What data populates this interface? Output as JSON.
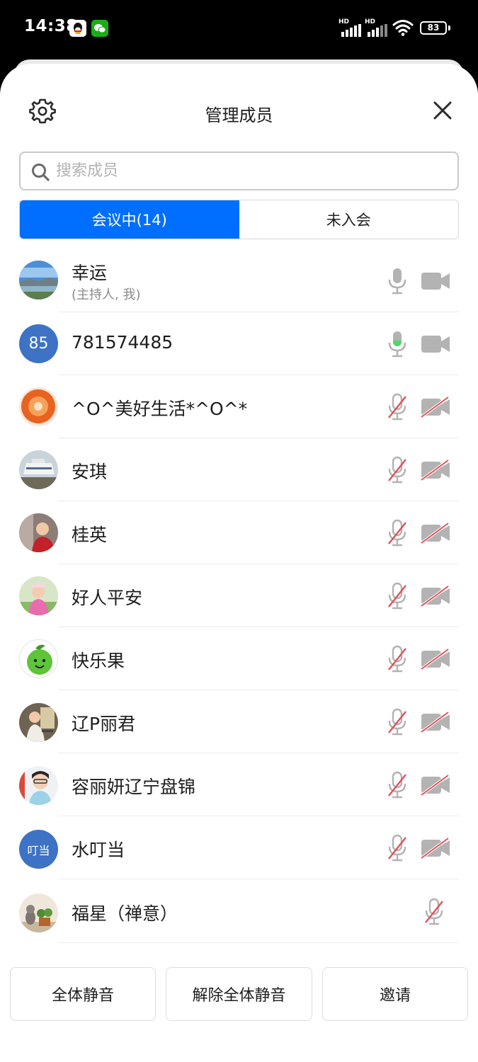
{
  "status_bar": {
    "time": "14:38",
    "signal1_label": "HD",
    "signal2_label": "HD",
    "battery": "83"
  },
  "header": {
    "title": "管理成员"
  },
  "search": {
    "placeholder": "搜索成员"
  },
  "tabs": [
    {
      "label": "会议中(14)",
      "active": true
    },
    {
      "label": "未入会",
      "active": false
    }
  ],
  "members": [
    {
      "name": "幸运",
      "subtitle": "(主持人, 我)",
      "avatar_text": "",
      "mic": "on",
      "camera": "on"
    },
    {
      "name": "781574485",
      "avatar_text": "85",
      "mic": "speaking",
      "camera": "on"
    },
    {
      "name": "^O^美好生活*^O^*",
      "avatar_text": "",
      "mic": "off",
      "camera": "off"
    },
    {
      "name": "安琪",
      "avatar_text": "",
      "mic": "off",
      "camera": "off"
    },
    {
      "name": "桂英",
      "avatar_text": "",
      "mic": "off",
      "camera": "off"
    },
    {
      "name": "好人平安",
      "avatar_text": "",
      "mic": "off",
      "camera": "off"
    },
    {
      "name": "快乐果",
      "avatar_text": "",
      "mic": "off",
      "camera": "off"
    },
    {
      "name": "辽P丽君",
      "avatar_text": "",
      "mic": "off",
      "camera": "off"
    },
    {
      "name": "容丽妍辽宁盘锦",
      "avatar_text": "",
      "mic": "off",
      "camera": "off"
    },
    {
      "name": "水叮当",
      "avatar_text": "叮当",
      "mic": "off",
      "camera": "off"
    },
    {
      "name": "福星（禅意）",
      "avatar_text": "",
      "mic": "off",
      "camera": "none"
    }
  ],
  "actions": {
    "mute_all": "全体静音",
    "unmute_all": "解除全体静音",
    "invite": "邀请"
  },
  "colors": {
    "accent": "#006fff",
    "speaking": "#4cd964",
    "muted_slash": "#e0525a",
    "icon_gray": "#b3b3b3"
  },
  "icons": [
    "settings-gear-icon",
    "close-icon",
    "search-icon",
    "microphone-icon",
    "microphone-muted-icon",
    "camera-icon",
    "camera-off-icon"
  ]
}
